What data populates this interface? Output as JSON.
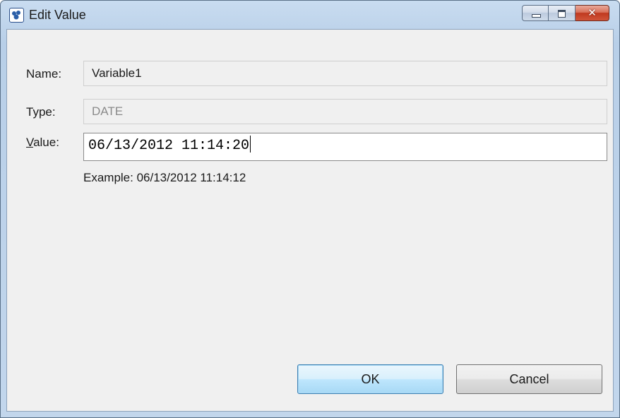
{
  "window": {
    "title": "Edit Value",
    "controls": {
      "minimize": "minimize-icon",
      "maximize": "maximize-icon",
      "close": "close-icon"
    }
  },
  "form": {
    "name": {
      "label": "Name:",
      "value": "Variable1"
    },
    "type": {
      "label": "Type:",
      "value": "DATE"
    },
    "value": {
      "label_accel": "V",
      "label_rest": "alue:",
      "value": "06/13/2012 11:14:20"
    },
    "example": "Example: 06/13/2012 11:14:12"
  },
  "buttons": {
    "ok": "OK",
    "cancel": "Cancel"
  },
  "colors": {
    "title_gradient": "#b8cfe8",
    "client_bg": "#f0f0f0",
    "close_button": "#c0391f",
    "default_button_border": "#3c7fb1"
  }
}
